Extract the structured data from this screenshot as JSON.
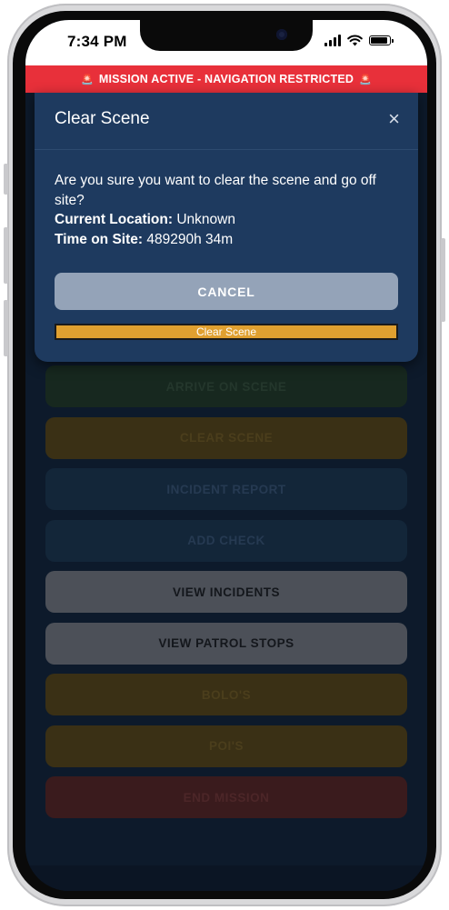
{
  "status_bar": {
    "time": "7:34 PM"
  },
  "banner": {
    "text": "MISSION ACTIVE - NAVIGATION RESTRICTED",
    "icon": "siren-icon"
  },
  "modal": {
    "title": "Clear Scene",
    "close_label": "×",
    "message": "Are you sure you want to clear the scene and go off site?",
    "location_label": "Current Location:",
    "location_value": "Unknown",
    "time_label": "Time on Site:",
    "time_value": "489290h 34m",
    "cancel_label": "CANCEL",
    "confirm_label": "Clear Scene"
  },
  "background_buttons": [
    {
      "label": "ARRIVE ON SCENE",
      "color": "#17281f"
    },
    {
      "label": "CLEAR SCENE",
      "color": "#3a3015"
    },
    {
      "label": "INCIDENT REPORT",
      "color": "#132639"
    },
    {
      "label": "ADD CHECK",
      "color": "#132639"
    },
    {
      "label": "VIEW INCIDENTS",
      "color": "#4c5058"
    },
    {
      "label": "VIEW PATROL STOPS",
      "color": "#4c5058"
    },
    {
      "label": "BOLO'S",
      "color": "#3a3015"
    },
    {
      "label": "POI'S",
      "color": "#3a3015"
    },
    {
      "label": "END MISSION",
      "color": "#3a1b1d"
    }
  ],
  "colors": {
    "banner": "#e8303a",
    "modal": "#1e3a5f",
    "cancel": "#94a3b8",
    "confirm": "#e0a030"
  }
}
